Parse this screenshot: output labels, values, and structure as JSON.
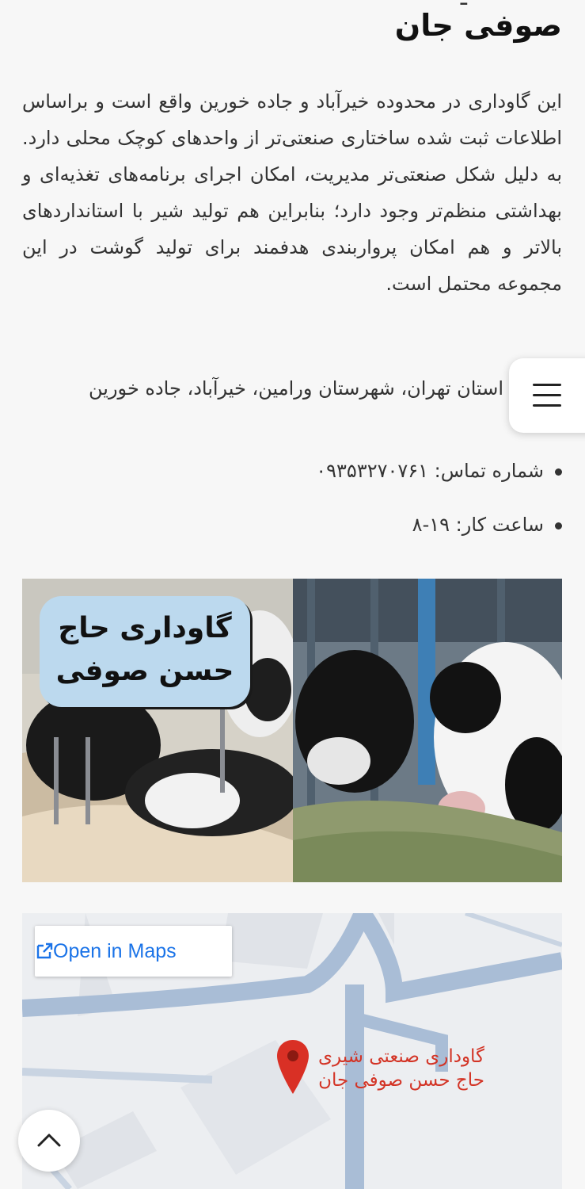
{
  "heading": {
    "title": "صوفی جان"
  },
  "description": "این گاوداری در محدوده خیرآباد و جاده خورین واقع است و براساس اطلاعات ثبت شده ساختاری صنعتی‌تر از واحدهای کوچک محلی دارد. به دلیل شکل صنعتی‌تر مدیریت، امکان اجرای برنامه‌های تغذیه‌ای و بهداشتی منظم‌تر وجود دارد؛ بنابراین هم تولید شیر با استانداردهای بالاتر و هم امکان پرواربندی هدفمند برای تولید گوشت در این مجموعه محتمل است.",
  "address": "آدرس: استان تهران، شهرستان ورامین، خیرآباد، جاده خورین",
  "contact": {
    "phone": "شماره تماس: ۰۹۳۵۳۲۷۰۷۶۱",
    "hours": "ساعت کار: ۱۹-۸"
  },
  "photo": {
    "label_line1": "گاوداری حاج",
    "label_line2": "حسن صوفی"
  },
  "map": {
    "open_label": "Open in Maps",
    "place_line1": "گاوداری صنعتی شیری",
    "place_line2": "حاج حسن صوفی جان",
    "pin_color": "#d93025",
    "road_color": "#a9bdd6"
  },
  "icons": {
    "menu": "hamburger-menu-icon",
    "external": "external-link-icon",
    "pin": "map-pin-icon",
    "scroll_top": "chevron-up-icon"
  }
}
